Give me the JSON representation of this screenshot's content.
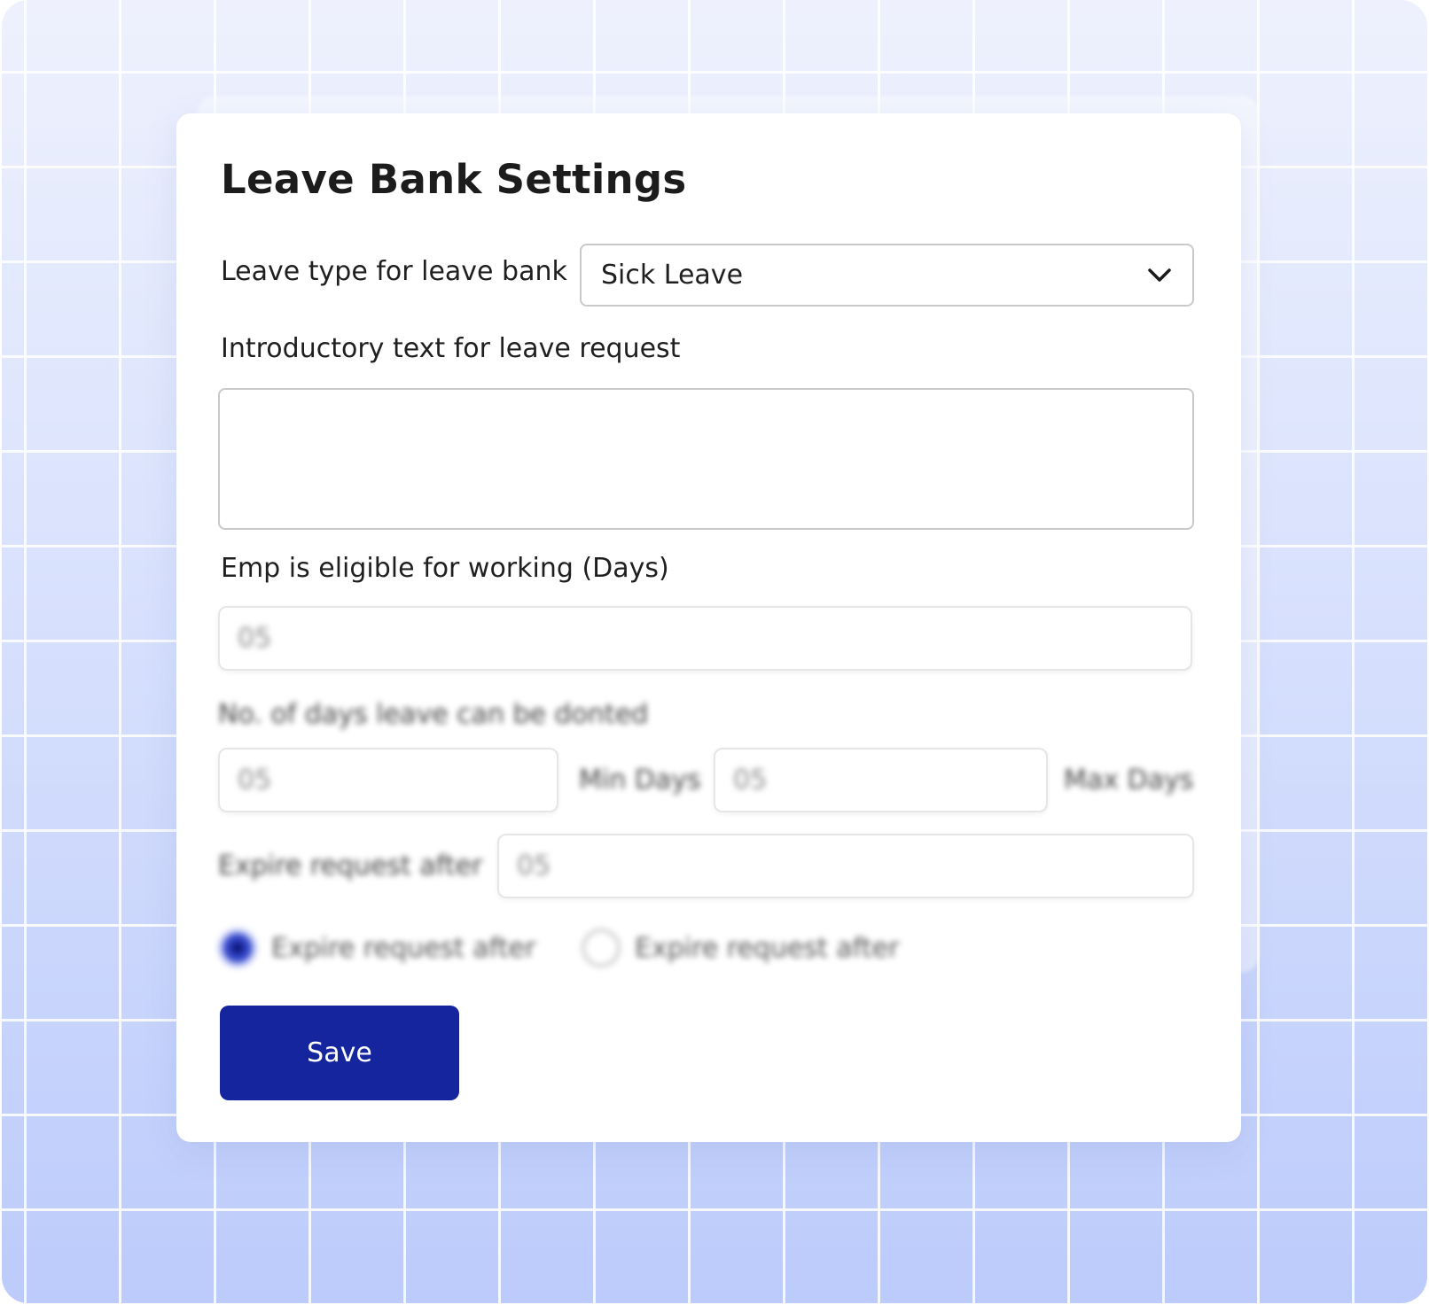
{
  "title": "Leave Bank Settings",
  "leave_type": {
    "label": "Leave type for leave bank",
    "value": "Sick Leave"
  },
  "intro_text": {
    "label": "Introductory text for leave request",
    "value": ""
  },
  "eligibility": {
    "label": "Emp is eligible for working (Days)",
    "value": "05"
  },
  "donation": {
    "label": "No. of days leave can be donted",
    "min_value": "05",
    "min_label": "Min Days",
    "max_value": "05",
    "max_label": "Max Days"
  },
  "expire": {
    "label": "Expire request after",
    "value": "05"
  },
  "radios": [
    {
      "label": "Expire request after",
      "checked": true
    },
    {
      "label": "Expire request after",
      "checked": false
    }
  ],
  "save_label": "Save",
  "colors": {
    "primary": "#14259e",
    "radio_accent": "#3446c8",
    "border": "#c9c9c9"
  },
  "icons": {
    "dropdown": "chevron-down-icon"
  }
}
